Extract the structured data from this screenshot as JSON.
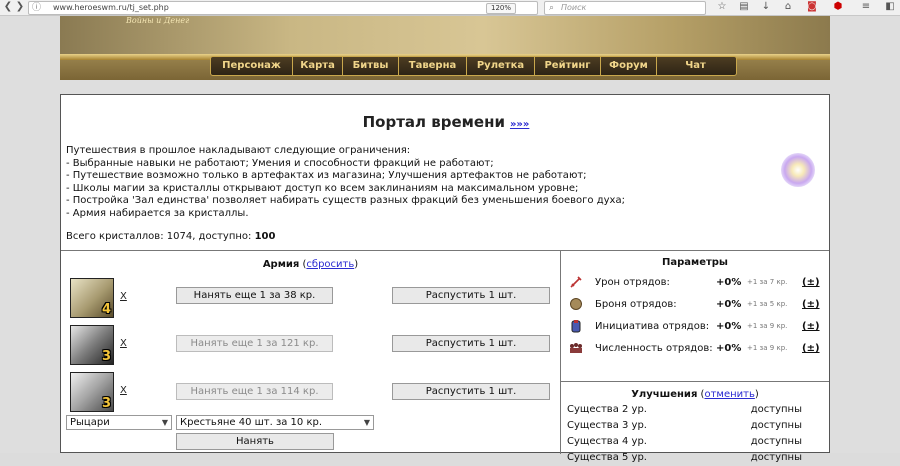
{
  "browser": {
    "url": "www.heroeswm.ru/tj_set.php",
    "zoom": "120%",
    "search_placeholder": "Поиск"
  },
  "site": {
    "logo_subtitle": "Войны и Денег",
    "menu": [
      "Персонаж",
      "Карта",
      "Битвы",
      "Таверна",
      "Рулетка",
      "Рейтинг",
      "Форум",
      "Чат"
    ]
  },
  "portal": {
    "title": "Портал времени",
    "title_link": "»»»",
    "lines": [
      "Путешествия в прошлое накладывают следующие ограничения:",
      "- Выбранные навыки не работают; Умения и способности фракций не работают;",
      "- Путешествие возможно только в артефактах из магазина; Улучшения артефактов не работают;",
      "- Школы магии за кристаллы открывают доступ ко всем заклинаниям на максимальном уровне;",
      "- Постройка 'Зал единства' позволяет набирать существ разных фракций без уменьшения боевого духа;",
      "- Армия набирается за кристаллы."
    ],
    "crystals_text": "Всего кристаллов: 1074, доступно:",
    "crystals_available": "100"
  },
  "army": {
    "title": "Армия",
    "reset": "сбросить",
    "units": [
      {
        "count": "4",
        "remove": "X",
        "hire": "Нанять еще 1 за 38 кр.",
        "hire_enabled": true,
        "dismiss": "Распустить 1 шт."
      },
      {
        "count": "3",
        "remove": "X",
        "hire": "Нанять еще 1 за 121 кр.",
        "hire_enabled": false,
        "dismiss": "Распустить 1 шт."
      },
      {
        "count": "3",
        "remove": "X",
        "hire": "Нанять еще 1 за 114 кр.",
        "hire_enabled": false,
        "dismiss": "Распустить 1 шт."
      }
    ],
    "faction_select": "Рыцари",
    "creature_select": "Крестьяне 40 шт. за 10 кр.",
    "buy_button": "Нанять"
  },
  "params": {
    "title": "Параметры",
    "rows": [
      {
        "label": "Урон отрядов:",
        "value": "+0%",
        "cost": "+1 за 7 кр.",
        "plus": "(±)"
      },
      {
        "label": "Броня отрядов:",
        "value": "+0%",
        "cost": "+1 за 5 кр.",
        "plus": "(±)"
      },
      {
        "label": "Инициатива отрядов:",
        "value": "+0%",
        "cost": "+1 за 9 кр.",
        "plus": "(±)"
      },
      {
        "label": "Численность отрядов:",
        "value": "+0%",
        "cost": "+1 за 9 кр.",
        "plus": "(±)"
      }
    ]
  },
  "upgrades": {
    "title": "Улучшения",
    "cancel": "отменить",
    "rows": [
      {
        "label": "Существа 2 ур.",
        "status": "доступны"
      },
      {
        "label": "Существа 3 ур.",
        "status": "доступны"
      },
      {
        "label": "Существа 4 ур.",
        "status": "доступны"
      },
      {
        "label": "Существа 5 ур.",
        "status": "доступны"
      }
    ]
  }
}
